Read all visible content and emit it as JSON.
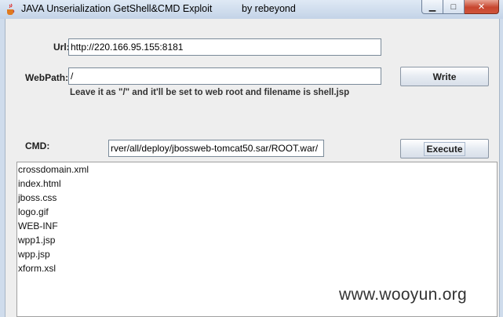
{
  "window": {
    "title": "JAVA Unserialization GetShell&CMD Exploit",
    "author": "by rebeyond",
    "controls": {
      "minimize": "▁",
      "maximize": "□",
      "close": "✕"
    }
  },
  "form": {
    "url_label": "Url:",
    "url_value": "http://220.166.95.155:8181",
    "webpath_label": "WebPath:",
    "webpath_value": "/",
    "write_button": "Write",
    "hint": "Leave it as \"/\" and it'll be set to web root and filename is shell.jsp",
    "cmd_label": "CMD:",
    "cmd_value": "rver/all/deploy/jbossweb-tomcat50.sar/ROOT.war/",
    "execute_button": "Execute"
  },
  "output": {
    "lines": [
      "crossdomain.xml",
      "index.html",
      "jboss.css",
      "logo.gif",
      "WEB-INF",
      "wpp1.jsp",
      "wpp.jsp",
      "xform.xsl"
    ]
  },
  "watermark": "www.wooyun.org",
  "colors": {
    "titlebar": "#cfdcec",
    "client_bg": "#eeeeee",
    "close_button": "#c7462f"
  }
}
